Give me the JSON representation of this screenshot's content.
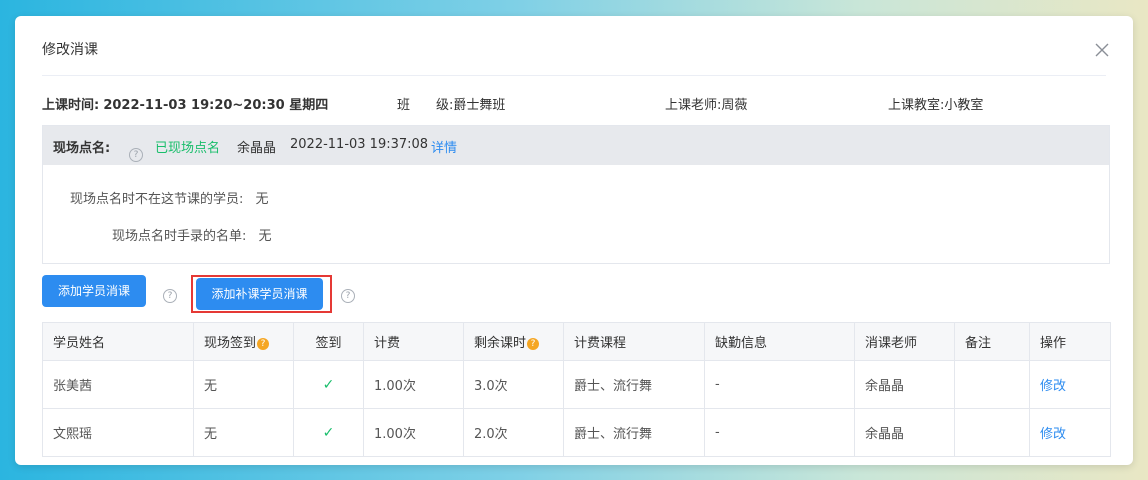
{
  "dialog": {
    "title": "修改消课",
    "close_icon": "close-icon"
  },
  "info": {
    "time_label": "上课时间:",
    "time_value": "2022-11-03 19:20~20:30 星期四",
    "class_label": "班　　级:",
    "class_value": "爵士舞班",
    "teacher_label": "上课老师:",
    "teacher_value": "周薇",
    "room_label": "上课教室:",
    "room_value": "小教室"
  },
  "rollcall": {
    "label": "现场点名:",
    "help_icon": "?",
    "status": "已现场点名",
    "status_color": "#19be6b",
    "operator": "余晶晶",
    "time": "2022-11-03 19:37:08",
    "detail_link": "详情",
    "absent_label": "现场点名时不在这节课的学员:",
    "absent_value": "无",
    "manual_label": "现场点名时手录的名单:",
    "manual_value": "无"
  },
  "actions": {
    "add_student_label": "添加学员消课",
    "add_makeup_label": "添加补课学员消课",
    "help_icon": "?",
    "accent": "#2d8cf0",
    "highlight_color": "#e53935"
  },
  "table": {
    "headers": [
      "学员姓名",
      "现场签到",
      "签到",
      "计费",
      "剩余课时",
      "计费课程",
      "缺勤信息",
      "消课老师",
      "备注",
      "操作"
    ],
    "rows": [
      {
        "name": "张美茜",
        "onsite": "无",
        "signed": "✓",
        "charge": "1.00次",
        "remaining": "3.0次",
        "course": "爵士、流行舞",
        "absence": "-",
        "teacher": "余晶晶",
        "note": "",
        "action": "修改"
      },
      {
        "name": "文熙瑶",
        "onsite": "无",
        "signed": "✓",
        "charge": "1.00次",
        "remaining": "2.0次",
        "course": "爵士、流行舞",
        "absence": "-",
        "teacher": "余晶晶",
        "note": "",
        "action": "修改"
      }
    ]
  }
}
